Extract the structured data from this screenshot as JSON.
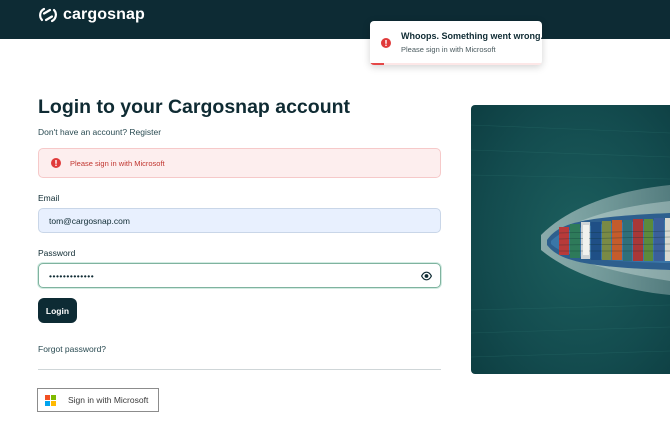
{
  "brand": {
    "name": "cargosnap",
    "header_color": "#0d2b34",
    "accent_color": "#0d2b34",
    "error_color": "#e54848",
    "logo_icon": "cargosnap-logo-icon"
  },
  "toast": {
    "title": "Whoops. Something went wrong.",
    "message": "Please sign in with Microsoft",
    "icon": "error-circle-icon",
    "progress": 0.08
  },
  "login": {
    "title": "Login to your Cargosnap account",
    "register_link": "Don't have an account? Register",
    "alert": {
      "icon": "error-circle-icon",
      "text": "Please sign in with Microsoft"
    },
    "email": {
      "label": "Email",
      "value": "tom@cargosnap.com"
    },
    "password": {
      "label": "Password",
      "masked_value": "•••••••••••••",
      "toggle_icon": "eye-icon"
    },
    "login_button": "Login",
    "forgot_password": "Forgot password?",
    "microsoft_button": {
      "label": "Sign in with Microsoft",
      "logo_colors": [
        "#f25022",
        "#7fba00",
        "#00a4ef",
        "#ffb900"
      ]
    }
  },
  "hero_image": {
    "subject": "aerial-container-ship-image",
    "sea_color": "#134b4e"
  }
}
